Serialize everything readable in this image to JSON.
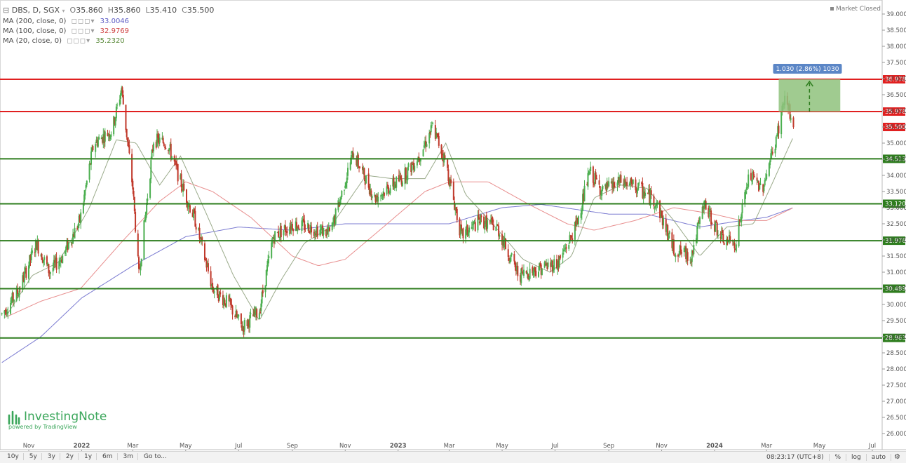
{
  "header": {
    "symbol": "DBS, D, SGX",
    "open_label": "O",
    "open": "35.860",
    "high_label": "H",
    "high": "35.860",
    "low_label": "L",
    "low": "35.410",
    "close_label": "C",
    "close": "35.500",
    "ma200_label": "MA (200, close, 0)",
    "ma200_value": "33.0046",
    "ma100_label": "MA (100, close, 0)",
    "ma100_value": "32.9769",
    "ma20_label": "MA (20, close, 0)",
    "ma20_value": "35.2320",
    "market_status": "Market Closed"
  },
  "logo": {
    "name": "InvestingNote",
    "sub": "powered by TradingView"
  },
  "bottom_bar": {
    "ranges": [
      "10y",
      "5y",
      "3y",
      "2y",
      "1y",
      "6m",
      "3m"
    ],
    "goto": "Go to...",
    "clock": "08:23:17 (UTC+8)",
    "percent": "%",
    "log": "log",
    "auto": "auto"
  },
  "colors": {
    "up": "#4caf50",
    "down": "#c0392b",
    "ma200": "#7b7bd1",
    "ma100": "#e88e8e",
    "ma20": "#9aaa8a",
    "resistance": "#e02020",
    "support": "#2e7d1e",
    "price_label": "#e02020",
    "measure_fill": "#8fc27c",
    "measure_label": "#5b86c6"
  },
  "chart_data": {
    "type": "candlestick",
    "x_tick_labels": [
      "Nov",
      "2022",
      "Mar",
      "May",
      "Jul",
      "Sep",
      "Nov",
      "2023",
      "Mar",
      "May",
      "Jul",
      "Sep",
      "Nov",
      "2024",
      "Mar",
      "May",
      "Jul"
    ],
    "x_tick_dates": [
      "2021-11-01",
      "2022-01-01",
      "2022-03-01",
      "2022-05-01",
      "2022-07-01",
      "2022-09-01",
      "2022-11-01",
      "2023-01-01",
      "2023-03-01",
      "2023-05-01",
      "2023-07-01",
      "2023-09-01",
      "2023-11-01",
      "2024-01-01",
      "2024-03-01",
      "2024-05-01",
      "2024-07-01"
    ],
    "y_range": [
      25.65,
      39.05
    ],
    "y_ticks": [
      "26.000",
      "26.500",
      "27.000",
      "27.500",
      "28.000",
      "28.500",
      "29.000",
      "29.500",
      "30.000",
      "30.500",
      "31.000",
      "31.500",
      "32.000",
      "32.500",
      "33.000",
      "33.500",
      "34.000",
      "34.500",
      "35.000",
      "35.500",
      "36.000",
      "36.500",
      "37.000",
      "37.500",
      "38.000",
      "38.500",
      "39.000"
    ],
    "price_path": [
      [
        "2021-10-01",
        29.7
      ],
      [
        "2021-10-20",
        30.4
      ],
      [
        "2021-11-10",
        31.9
      ],
      [
        "2021-11-25",
        31.0
      ],
      [
        "2021-12-10",
        31.5
      ],
      [
        "2021-12-30",
        32.6
      ],
      [
        "2022-01-15",
        35.0
      ],
      [
        "2022-02-05",
        35.4
      ],
      [
        "2022-02-16",
        36.7
      ],
      [
        "2022-03-01",
        33.6
      ],
      [
        "2022-03-08",
        30.9
      ],
      [
        "2022-03-25",
        35.1
      ],
      [
        "2022-04-10",
        35.0
      ],
      [
        "2022-04-25",
        33.8
      ],
      [
        "2022-05-12",
        32.6
      ],
      [
        "2022-06-01",
        30.5
      ],
      [
        "2022-06-20",
        30.0
      ],
      [
        "2022-07-05",
        29.3
      ],
      [
        "2022-07-25",
        29.8
      ],
      [
        "2022-08-10",
        32.1
      ],
      [
        "2022-09-01",
        32.5
      ],
      [
        "2022-09-20",
        32.4
      ],
      [
        "2022-10-15",
        32.2
      ],
      [
        "2022-11-10",
        34.7
      ],
      [
        "2022-12-05",
        33.3
      ],
      [
        "2023-01-05",
        33.9
      ],
      [
        "2023-01-25",
        34.6
      ],
      [
        "2023-02-10",
        35.5
      ],
      [
        "2023-02-25",
        34.4
      ],
      [
        "2023-03-15",
        32.1
      ],
      [
        "2023-04-05",
        32.6
      ],
      [
        "2023-04-25",
        32.4
      ],
      [
        "2023-05-20",
        30.9
      ],
      [
        "2023-06-10",
        31.1
      ],
      [
        "2023-07-05",
        31.3
      ],
      [
        "2023-07-25",
        32.4
      ],
      [
        "2023-08-10",
        34.1
      ],
      [
        "2023-08-25",
        33.5
      ],
      [
        "2023-09-15",
        33.8
      ],
      [
        "2023-10-05",
        33.6
      ],
      [
        "2023-10-25",
        33.2
      ],
      [
        "2023-11-15",
        31.7
      ],
      [
        "2023-12-05",
        31.5
      ],
      [
        "2023-12-20",
        33.1
      ],
      [
        "2024-01-10",
        32.0
      ],
      [
        "2024-01-25",
        31.9
      ],
      [
        "2024-02-10",
        34.0
      ],
      [
        "2024-02-25",
        33.6
      ],
      [
        "2024-03-12",
        35.1
      ],
      [
        "2024-03-22",
        36.4
      ],
      [
        "2024-04-01",
        35.5
      ]
    ],
    "ma20_path": [
      [
        "2021-10-05",
        29.6
      ],
      [
        "2021-11-05",
        30.9
      ],
      [
        "2021-12-05",
        31.3
      ],
      [
        "2022-01-10",
        33.0
      ],
      [
        "2022-02-10",
        35.1
      ],
      [
        "2022-03-05",
        35.0
      ],
      [
        "2022-04-01",
        33.7
      ],
      [
        "2022-04-25",
        34.6
      ],
      [
        "2022-05-25",
        32.8
      ],
      [
        "2022-06-25",
        30.9
      ],
      [
        "2022-07-25",
        29.5
      ],
      [
        "2022-08-20",
        30.8
      ],
      [
        "2022-09-15",
        31.9
      ],
      [
        "2022-10-15",
        32.4
      ],
      [
        "2022-11-25",
        34.0
      ],
      [
        "2022-12-25",
        33.9
      ],
      [
        "2023-02-01",
        33.9
      ],
      [
        "2023-02-25",
        35.0
      ],
      [
        "2023-03-20",
        33.4
      ],
      [
        "2023-04-20",
        32.5
      ],
      [
        "2023-05-25",
        31.4
      ],
      [
        "2023-06-25",
        31.0
      ],
      [
        "2023-07-20",
        31.5
      ],
      [
        "2023-08-15",
        33.3
      ],
      [
        "2023-09-15",
        33.7
      ],
      [
        "2023-10-15",
        33.6
      ],
      [
        "2023-11-15",
        32.6
      ],
      [
        "2023-12-15",
        31.5
      ],
      [
        "2024-01-15",
        32.4
      ],
      [
        "2024-02-15",
        32.5
      ],
      [
        "2024-03-05",
        33.6
      ],
      [
        "2024-04-01",
        35.2
      ]
    ],
    "ma100_path": [
      [
        "2021-10-05",
        29.6
      ],
      [
        "2021-11-15",
        30.1
      ],
      [
        "2021-12-31",
        30.5
      ],
      [
        "2022-02-15",
        31.9
      ],
      [
        "2022-04-01",
        33.2
      ],
      [
        "2022-05-01",
        33.8
      ],
      [
        "2022-06-01",
        33.5
      ],
      [
        "2022-07-15",
        32.7
      ],
      [
        "2022-09-01",
        31.5
      ],
      [
        "2022-10-01",
        31.2
      ],
      [
        "2022-11-01",
        31.4
      ],
      [
        "2022-12-15",
        32.4
      ],
      [
        "2023-02-01",
        33.5
      ],
      [
        "2023-03-01",
        33.8
      ],
      [
        "2023-04-15",
        33.8
      ],
      [
        "2023-06-01",
        33.1
      ],
      [
        "2023-07-15",
        32.5
      ],
      [
        "2023-08-15",
        32.3
      ],
      [
        "2023-10-01",
        32.6
      ],
      [
        "2023-11-15",
        33.0
      ],
      [
        "2023-12-31",
        32.8
      ],
      [
        "2024-02-01",
        32.6
      ],
      [
        "2024-03-01",
        32.6
      ],
      [
        "2024-04-01",
        33.0
      ]
    ],
    "ma200_path": [
      [
        "2021-10-01",
        28.2
      ],
      [
        "2021-11-15",
        29.0
      ],
      [
        "2022-01-01",
        30.2
      ],
      [
        "2022-03-01",
        31.2
      ],
      [
        "2022-05-01",
        32.1
      ],
      [
        "2022-07-01",
        32.4
      ],
      [
        "2022-09-01",
        32.3
      ],
      [
        "2022-11-01",
        32.5
      ],
      [
        "2023-01-01",
        32.5
      ],
      [
        "2023-03-01",
        32.5
      ],
      [
        "2023-05-01",
        33.0
      ],
      [
        "2023-06-15",
        33.1
      ],
      [
        "2023-09-01",
        32.8
      ],
      [
        "2023-10-15",
        32.8
      ],
      [
        "2023-12-15",
        32.4
      ],
      [
        "2024-02-01",
        32.6
      ],
      [
        "2024-03-01",
        32.7
      ],
      [
        "2024-04-01",
        33.0
      ]
    ],
    "horizontal_levels": [
      {
        "value": 36.978,
        "label": "36.978",
        "kind": "resistance"
      },
      {
        "value": 35.978,
        "label": "35.978",
        "kind": "resistance"
      },
      {
        "value": 34.513,
        "label": "34.513",
        "kind": "support"
      },
      {
        "value": 33.12,
        "label": "33.120",
        "kind": "support"
      },
      {
        "value": 31.976,
        "label": "31.976",
        "kind": "support"
      },
      {
        "value": 30.489,
        "label": "30.489",
        "kind": "support"
      },
      {
        "value": 28.963,
        "label": "28.963",
        "kind": "support"
      }
    ],
    "current_price": {
      "value": 35.5,
      "label": "35.500"
    },
    "measure": {
      "from_date": "2024-03-15",
      "to_date": "2024-05-25",
      "from_value": 35.978,
      "to_value": 36.978,
      "label": "1.030 (2.86%) 1030"
    }
  }
}
